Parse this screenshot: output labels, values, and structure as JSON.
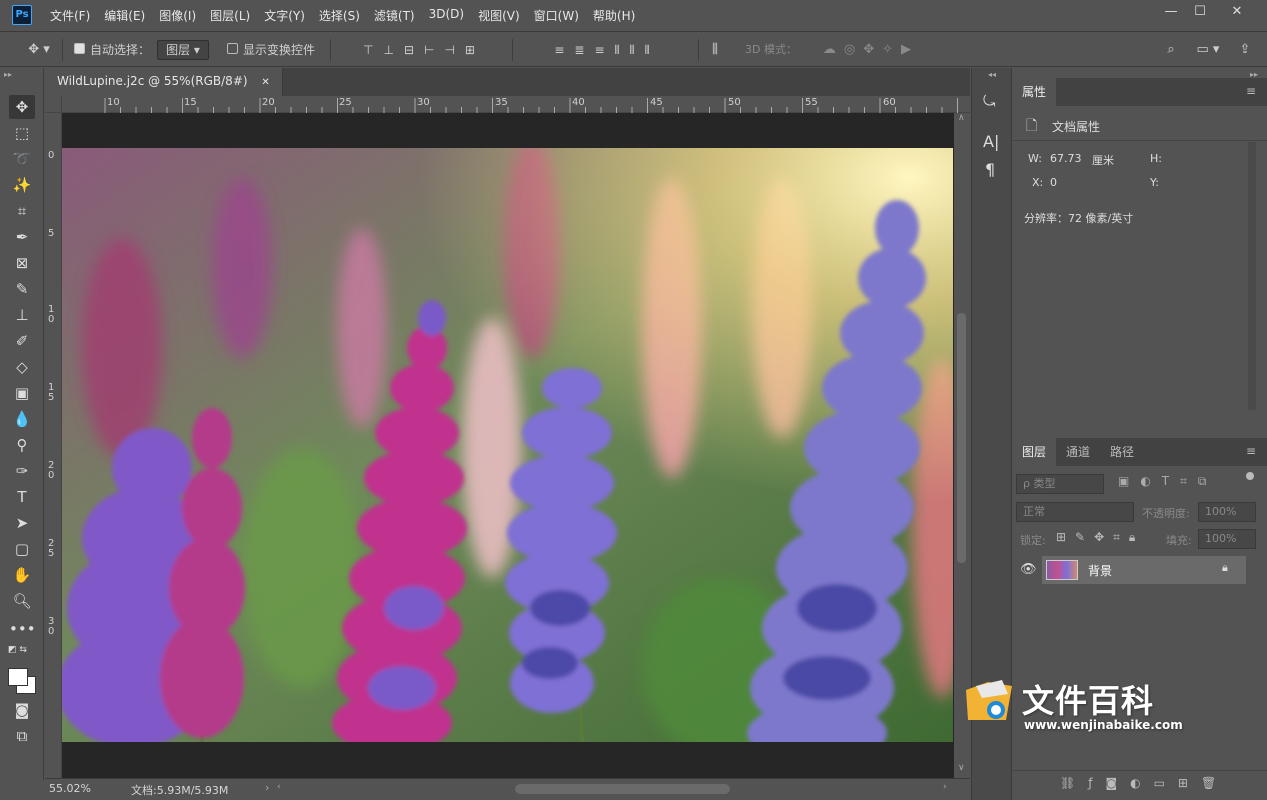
{
  "app": {
    "logo": "Ps"
  },
  "menu": [
    "文件(F)",
    "编辑(E)",
    "图像(I)",
    "图层(L)",
    "文字(Y)",
    "选择(S)",
    "滤镜(T)",
    "3D(D)",
    "视图(V)",
    "窗口(W)",
    "帮助(H)"
  ],
  "options": {
    "auto_select_label": "自动选择：",
    "auto_select_checked": true,
    "auto_select_value": "图层",
    "show_transform_label": "显示变换控件",
    "mode_3d_label": "3D 模式："
  },
  "document": {
    "tab_title": "WildLupine.j2c @ 55%(RGB/8#)",
    "zoom": "55.02%",
    "doc_size": "文档:5.93M/5.93M"
  },
  "rulers": {
    "h": [
      "10",
      "15",
      "20",
      "25",
      "30",
      "35",
      "40",
      "45",
      "50",
      "55",
      "60"
    ],
    "v": [
      "0",
      "5",
      "1\n0",
      "1\n5",
      "2\n0",
      "2\n5",
      "3\n0"
    ]
  },
  "properties": {
    "tab": "属性",
    "section_title": "文档属性",
    "w_label": "W:",
    "w_value": "67.73",
    "w_unit": "厘米",
    "h_label": "H:",
    "x_label": "X:",
    "x_value": "0",
    "y_label": "Y:",
    "resolution": "分辨率：72 像素/英寸"
  },
  "layers_panel": {
    "tabs": [
      "图层",
      "通道",
      "路径"
    ],
    "filter_label": "ρ 类型",
    "blend_mode": "正常",
    "opacity_label": "不透明度:",
    "opacity_value": "100%",
    "lock_label": "锁定:",
    "fill_label": "填充:",
    "fill_value": "100%",
    "layers": [
      {
        "name": "背景",
        "visible": true,
        "locked": true
      }
    ]
  },
  "watermark": {
    "title": "文件百科",
    "url": "www.wenjinabaike.com"
  },
  "colors": {
    "chrome": "#535353",
    "dark": "#424242",
    "canvas_bg": "#262626",
    "ps_blue": "#3ea8ff"
  }
}
